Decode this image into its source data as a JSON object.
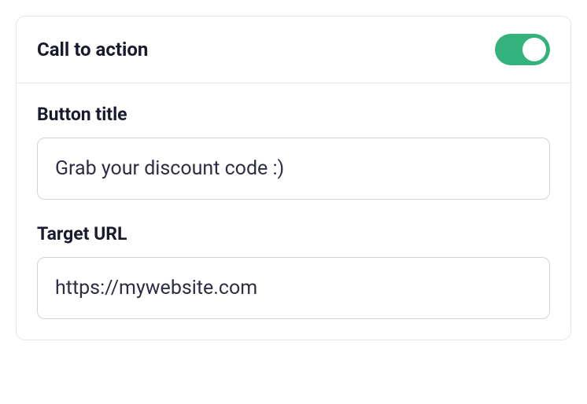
{
  "section": {
    "title": "Call to action",
    "enabled": true
  },
  "fields": {
    "button_title": {
      "label": "Button title",
      "value": "Grab your discount code :)"
    },
    "target_url": {
      "label": "Target URL",
      "value": "https://mywebsite.com"
    }
  },
  "colors": {
    "toggle_on": "#34b27b",
    "border": "#e5e7eb",
    "text": "#1a1a2e"
  }
}
